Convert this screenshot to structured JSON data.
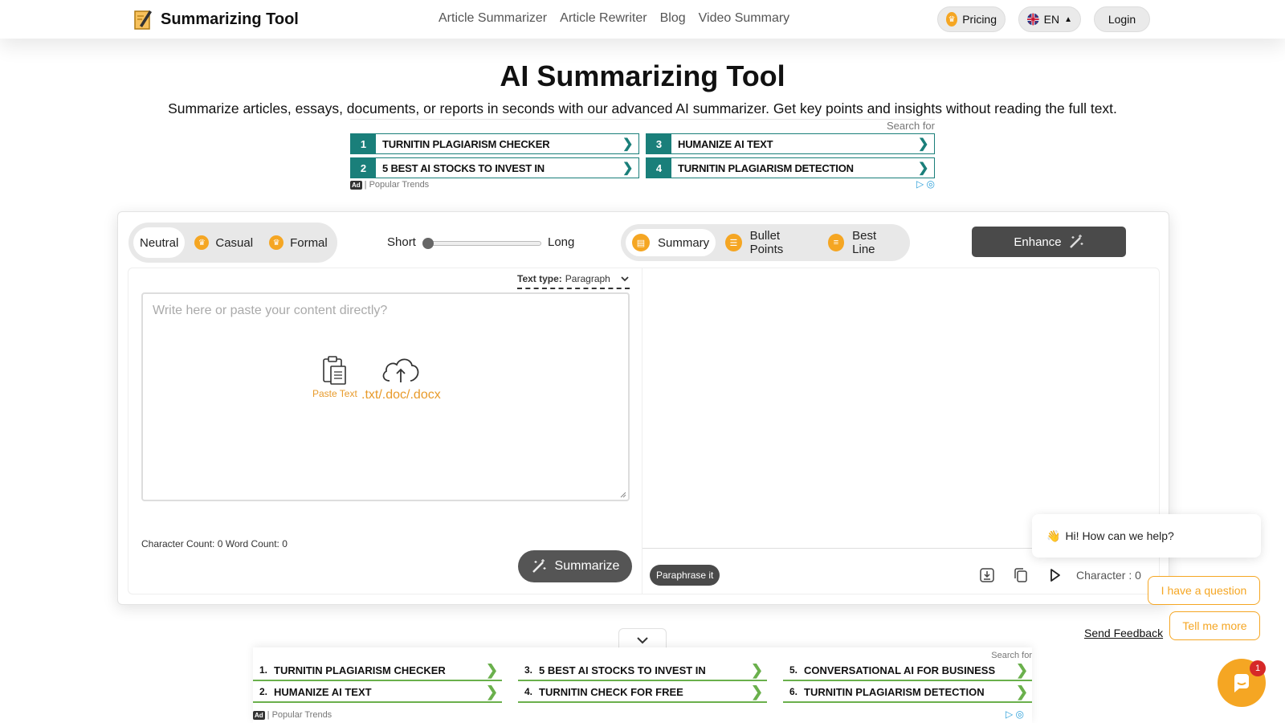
{
  "header": {
    "logo_text": "Summarizing Tool",
    "nav": [
      "Article Summarizer",
      "Article Rewriter",
      "Blog",
      "Video Summary"
    ],
    "pricing_label": "Pricing",
    "language_label": "EN",
    "login_label": "Login"
  },
  "hero": {
    "title": "AI Summarizing Tool",
    "subtitle": "Summarize articles, essays, documents, or reports in seconds with our advanced AI summarizer. Get key points and insights without reading the full text."
  },
  "ad_top": {
    "search_for": "Search for",
    "items": [
      {
        "num": "1",
        "label": "TURNITIN PLAGIARISM CHECKER"
      },
      {
        "num": "2",
        "label": "5 BEST AI STOCKS TO INVEST IN"
      },
      {
        "num": "3",
        "label": "HUMANIZE AI TEXT"
      },
      {
        "num": "4",
        "label": "TURNITIN PLAGIARISM DETECTION"
      }
    ],
    "ad_badge": "Ad",
    "footer": "| Popular Trends"
  },
  "tool": {
    "tones": [
      "Neutral",
      "Casual",
      "Formal"
    ],
    "length_short": "Short",
    "length_long": "Long",
    "length_value": 0,
    "modes": [
      "Summary",
      "Bullet Points",
      "Best Line"
    ],
    "enhance_label": "Enhance",
    "text_type_label": "Text type:",
    "text_type_value": "Paragraph",
    "placeholder": "Write here or paste your content directly?",
    "paste_label": "Paste Text",
    "upload_label": ".txt/.doc/.docx",
    "counts": "Character Count: 0 Word Count: 0",
    "summarize_label": "Summarize",
    "paraphrase_label": "Paraphrase it",
    "char_count": "Character : 0"
  },
  "feedback_label": "Send Feedback",
  "chat": {
    "greeting": "Hi! How can we help?",
    "question": "I have a question",
    "tell_more": "Tell me more",
    "badge": "1"
  },
  "ad_bottom": {
    "search_for": "Search for",
    "items": [
      {
        "num": "1.",
        "label": "TURNITIN PLAGIARISM CHECKER"
      },
      {
        "num": "2.",
        "label": "HUMANIZE AI TEXT"
      },
      {
        "num": "3.",
        "label": "5 BEST AI STOCKS TO INVEST IN"
      },
      {
        "num": "4.",
        "label": "TURNITIN CHECK FOR FREE"
      },
      {
        "num": "5.",
        "label": "CONVERSATIONAL AI FOR BUSINESS"
      },
      {
        "num": "6.",
        "label": "TURNITIN PLAGIARISM DETECTION"
      }
    ],
    "ad_badge": "Ad",
    "footer": "| Popular Trends"
  },
  "colors": {
    "accent": "#f5a623",
    "ad_teal": "#1a7f7a",
    "ad_green": "#6ab04c",
    "dark_button": "#4a4a4a"
  }
}
